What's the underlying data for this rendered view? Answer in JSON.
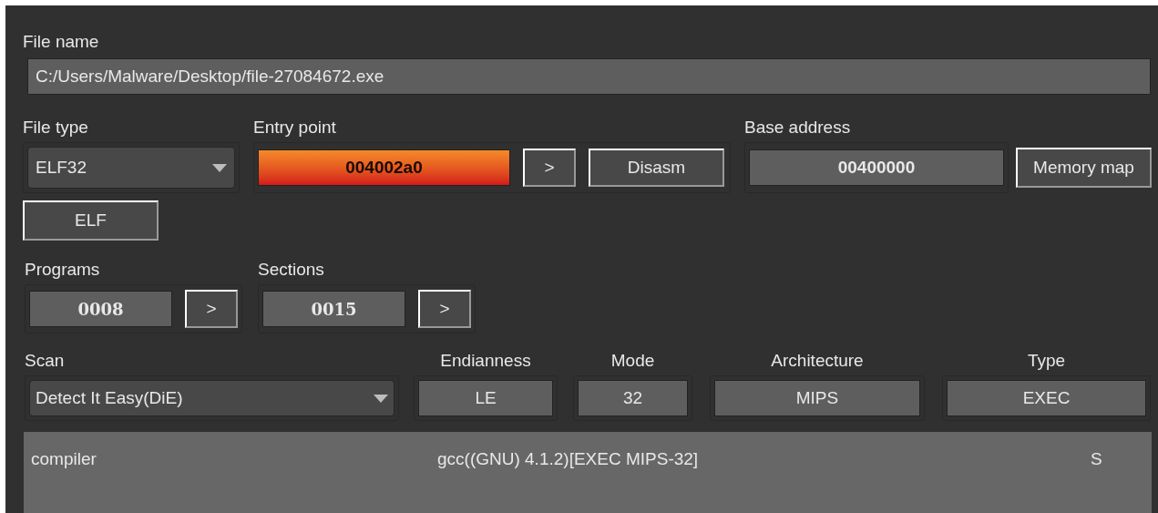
{
  "file_name": {
    "label": "File name",
    "value": "C:/Users/Malware/Desktop/file-27084672.exe"
  },
  "file_type": {
    "label": "File type",
    "value": "ELF32"
  },
  "entry_point": {
    "label": "Entry point",
    "value": "004002a0",
    "highlighted": true,
    "buttons": [
      ">",
      "Disasm"
    ]
  },
  "base_address": {
    "label": "Base address",
    "value": "00400000",
    "button": "Memory map"
  },
  "format_button": "ELF",
  "programs": {
    "label": "Programs",
    "value": "0008",
    "button": ">"
  },
  "sections": {
    "label": "Sections",
    "value": "0015",
    "button": ">"
  },
  "scan": {
    "label": "Scan",
    "value": "Detect It Easy(DiE)"
  },
  "info_fields": [
    {
      "label": "Endianness",
      "value": "LE"
    },
    {
      "label": "Mode",
      "value": "32"
    },
    {
      "label": "Architecture",
      "value": "MIPS"
    },
    {
      "label": "Type",
      "value": "EXEC"
    }
  ],
  "results": [
    {
      "type": "compiler",
      "name": "gcc((GNU) 4.1.2)[EXEC MIPS-32]",
      "flag": "S"
    }
  ]
}
